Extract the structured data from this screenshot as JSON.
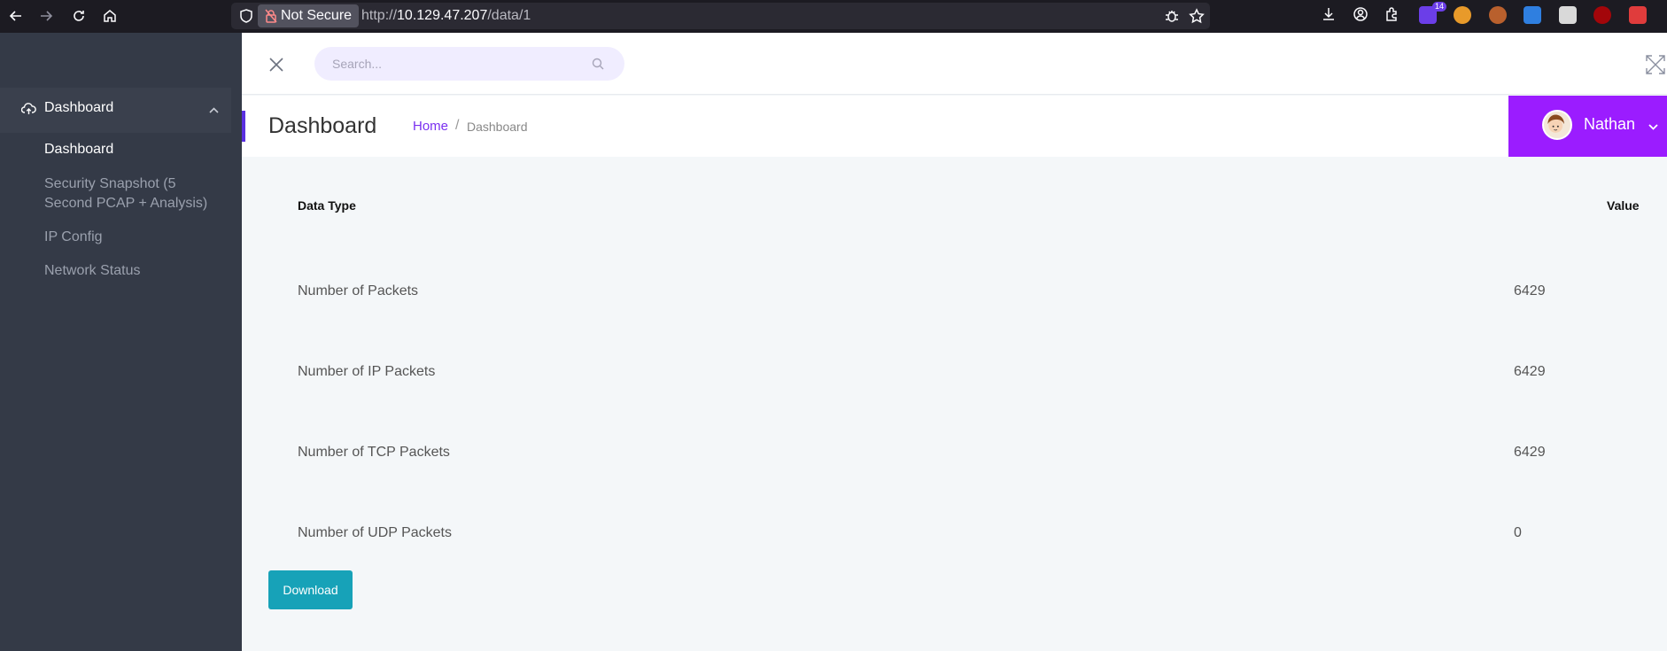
{
  "browser": {
    "security_label": "Not Secure",
    "url_scheme": "http://",
    "url_host": "10.129.47.207",
    "url_path": "/data/1",
    "extension_badge": "14"
  },
  "sidebar": {
    "group_label": "Dashboard",
    "items": [
      {
        "label": "Dashboard"
      },
      {
        "label": "Security Snapshot (5"
      },
      {
        "label": "Second PCAP + Analysis)"
      },
      {
        "label": "IP Config"
      },
      {
        "label": "Network Status"
      }
    ]
  },
  "header": {
    "search_placeholder": "Search..."
  },
  "page": {
    "title": "Dashboard",
    "breadcrumb_home": "Home",
    "breadcrumb_sep": "/",
    "breadcrumb_current": "Dashboard"
  },
  "user": {
    "name": "Nathan"
  },
  "table": {
    "columns": [
      "Data Type",
      "Value"
    ],
    "rows": [
      {
        "type": "Number of Packets",
        "value": "6429"
      },
      {
        "type": "Number of IP Packets",
        "value": "6429"
      },
      {
        "type": "Number of TCP Packets",
        "value": "6429"
      },
      {
        "type": "Number of UDP Packets",
        "value": "0"
      }
    ]
  },
  "actions": {
    "download_label": "Download"
  },
  "colors": {
    "accent": "#9b1cff",
    "sidebar": "#343a47",
    "button": "#17a2b8"
  }
}
